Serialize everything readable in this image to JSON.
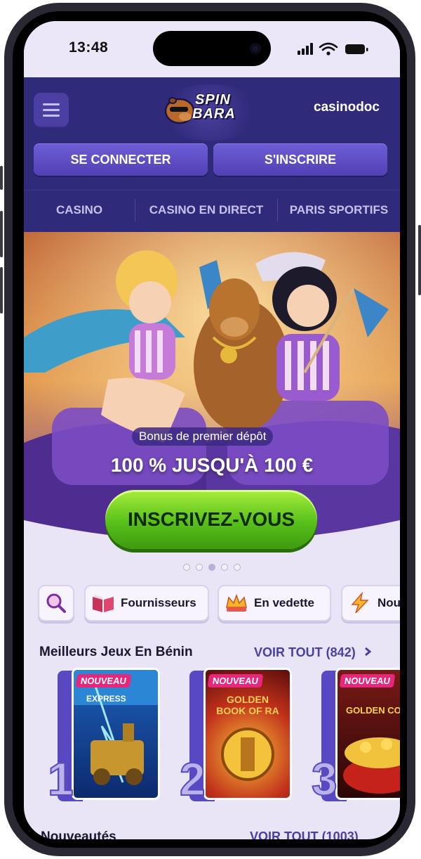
{
  "status": {
    "time": "13:48"
  },
  "header": {
    "logo_line1": "SPIN",
    "logo_line2": "BARA",
    "watermark": "casinodoc"
  },
  "auth": {
    "login_label": "SE CONNECTER",
    "signup_label": "S'INSCRIRE"
  },
  "nav": {
    "items": [
      {
        "label": "CASINO"
      },
      {
        "label": "CASINO EN DIRECT"
      },
      {
        "label": "PARIS SPORTIFS"
      }
    ]
  },
  "banner": {
    "badge": "Bonus de premier dépôt",
    "headline": "100 % JUSQU'À 100 €",
    "cta": "INSCRIVEZ-VOUS",
    "slides_total": 5,
    "active_slide": 3
  },
  "categories": [
    {
      "label": "Fournisseurs",
      "icon": "book-icon"
    },
    {
      "label": "En vedette",
      "icon": "crown-icon"
    },
    {
      "label": "Nou",
      "icon": "lightning-icon"
    }
  ],
  "top_games": {
    "title": "Meilleurs Jeux En Bénin",
    "link": "VOIR TOUT (842)",
    "games": [
      {
        "rank": "1",
        "tag": "NOUVEAU",
        "name": "EXPRESS"
      },
      {
        "rank": "2",
        "tag": "NOUVEAU",
        "name": "GOLDEN BOOK OF RA"
      },
      {
        "rank": "3",
        "tag": "NOUVEAU",
        "name": "GOLDEN CO"
      }
    ]
  },
  "new_games": {
    "title": "Nouveautés",
    "link": "VOIR TOUT (1003)"
  },
  "colors": {
    "brand": "#2f2a7a",
    "cta": "#58c01a",
    "accent": "#4b3fa3",
    "tag": "#e8267b"
  }
}
